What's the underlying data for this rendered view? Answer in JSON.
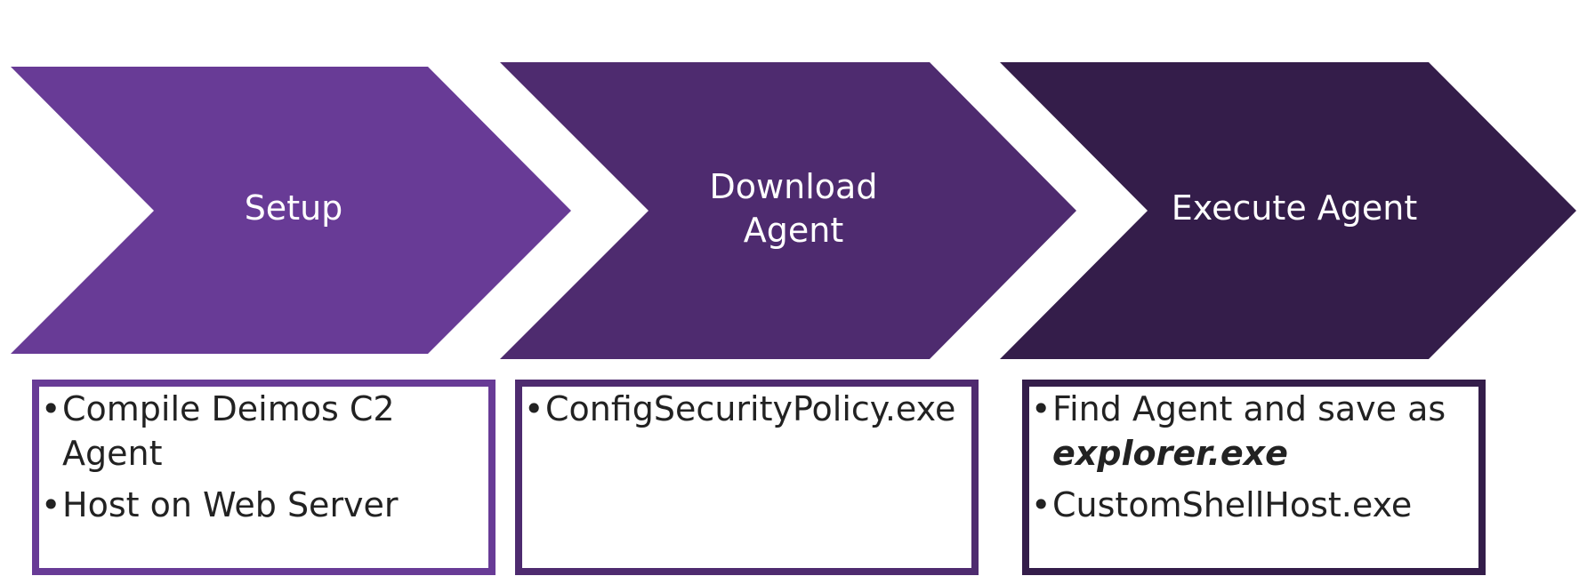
{
  "colors": {
    "step1": "#683b96",
    "step2": "#4e2b6f",
    "step3": "#341d4a"
  },
  "steps": [
    {
      "title_lines": [
        "Setup"
      ],
      "bullets": [
        "Compile Deimos C2 Agent",
        "Host on Web Server"
      ]
    },
    {
      "title_lines": [
        "Download",
        "Agent"
      ],
      "bullets": [
        "ConfigSecurityPolicy.exe"
      ]
    },
    {
      "title_lines": [
        "Execute Agent"
      ],
      "bullets_rich": [
        {
          "text": "Find Agent and save as ",
          "emphasis": "explorer.exe"
        },
        {
          "text": "CustomShellHost.exe"
        }
      ]
    }
  ]
}
